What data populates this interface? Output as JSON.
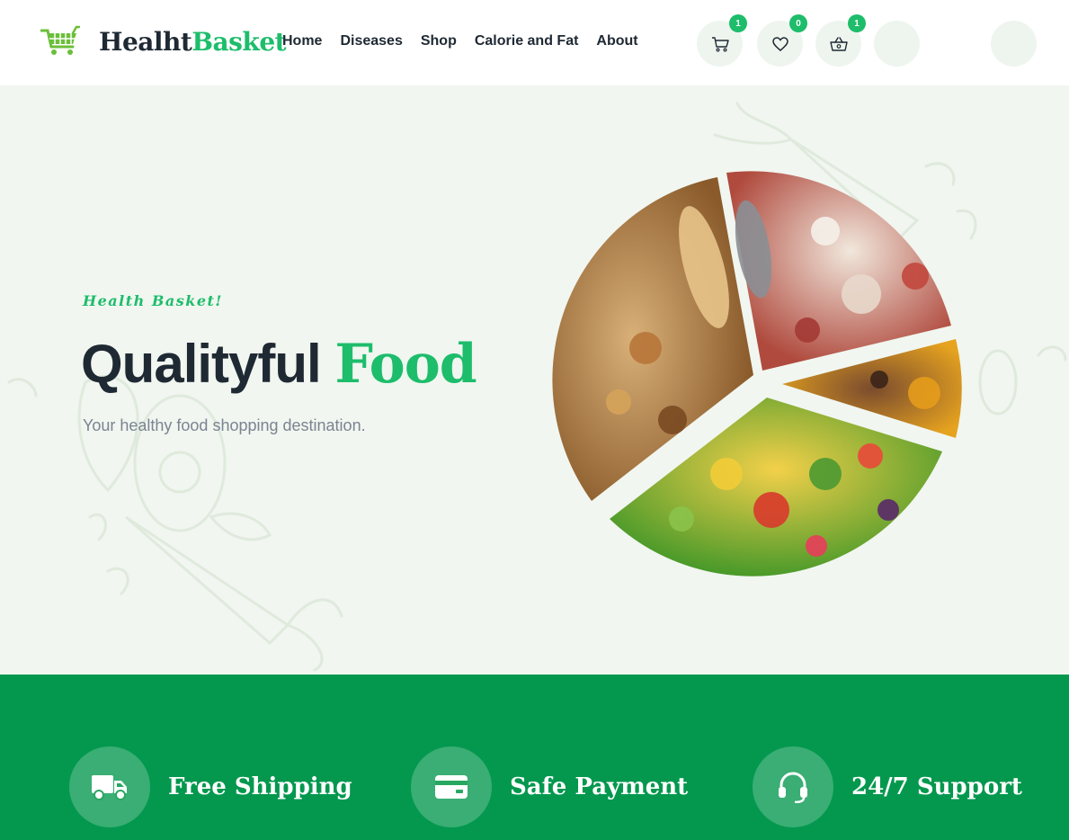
{
  "brand": {
    "name_part1": "Healht",
    "name_part2": "Basket"
  },
  "nav": {
    "items": [
      {
        "label": "Home"
      },
      {
        "label": "Diseases"
      },
      {
        "label": "Shop"
      },
      {
        "label": "Calorie and Fat"
      },
      {
        "label": "About"
      }
    ]
  },
  "header_actions": {
    "cart": {
      "icon": "cart-icon",
      "count": "1"
    },
    "wishlist": {
      "icon": "heart-icon",
      "count": "0"
    },
    "basket": {
      "icon": "basket-icon",
      "count": "1"
    }
  },
  "hero": {
    "eyebrow": "Health Basket!",
    "headline_dark": "Qualityful",
    "headline_green": "Food",
    "subtitle": "Your healthy food shopping destination."
  },
  "features": [
    {
      "icon": "truck-icon",
      "label": "Free Shipping"
    },
    {
      "icon": "credit-card-icon",
      "label": "Safe Payment"
    },
    {
      "icon": "headset-icon",
      "label": "24/7 Support"
    }
  ],
  "colors": {
    "accent": "#1dbd6b",
    "dark": "#1f2933",
    "hero_bg": "#f1f6f0",
    "feature_bg": "#03984e"
  }
}
